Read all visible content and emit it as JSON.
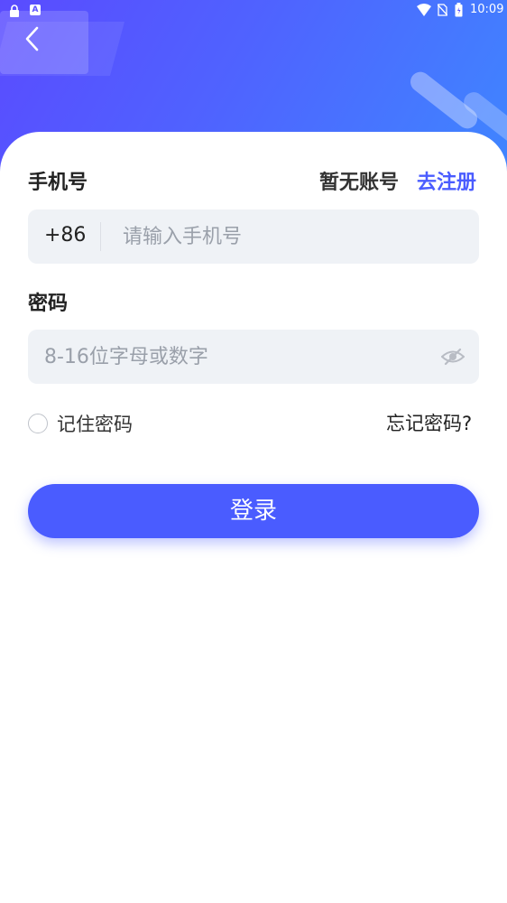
{
  "status_bar": {
    "time": "10:09",
    "icons": [
      "lock-icon",
      "accessibility-a-icon",
      "wifi-icon",
      "no-sim-icon",
      "battery-icon"
    ],
    "a_glyph": "A"
  },
  "nav": {
    "back_icon": "chevron-left-icon"
  },
  "form": {
    "phone_label": "手机号",
    "no_account_text": "暂无账号",
    "register_link": "去注册",
    "country_code": "+86",
    "phone_placeholder": "请输入手机号",
    "password_label": "密码",
    "password_placeholder": "8-16位字母或数字",
    "password_visibility_icon": "eye-off-icon",
    "remember_label": "记住密码",
    "remember_checked": false,
    "forgot_link": "忘记密码?",
    "login_button": "登录"
  },
  "colors": {
    "accent": "#4a5cff",
    "header_gradient_start": "#5a4bff",
    "header_gradient_end": "#3f86ff",
    "input_bg": "#eff2f6"
  }
}
